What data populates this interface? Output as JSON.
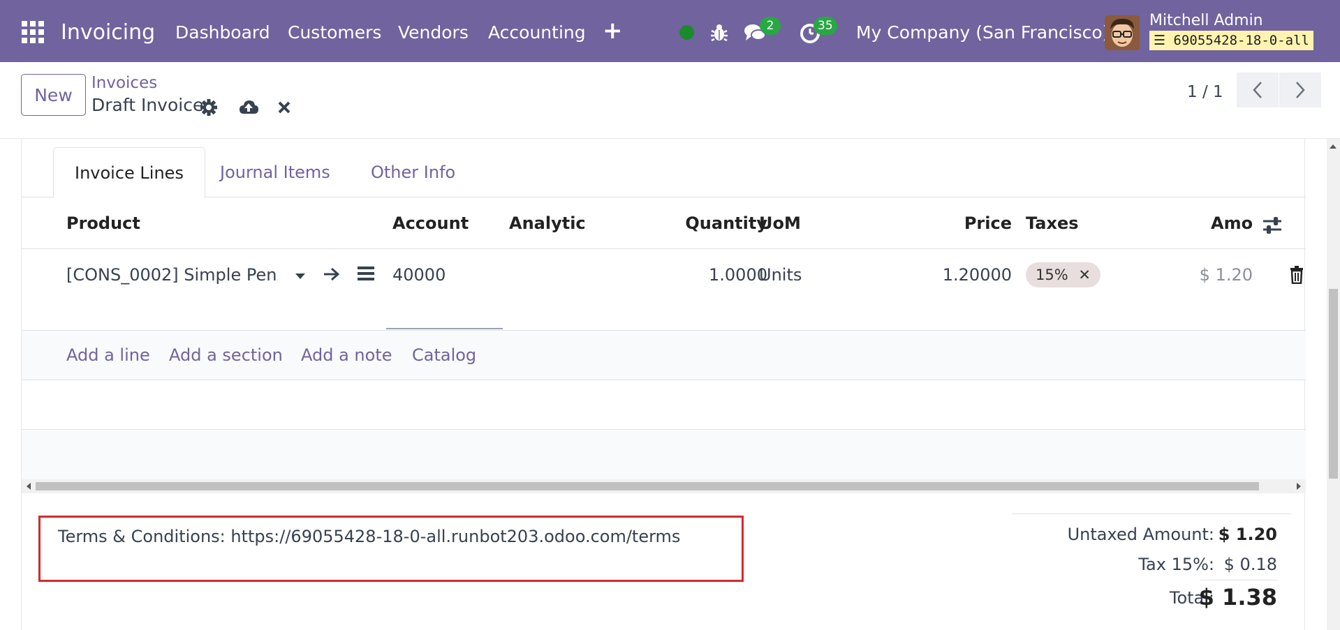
{
  "navbar": {
    "brand": "Invoicing",
    "menu": [
      "Dashboard",
      "Customers",
      "Vendors",
      "Accounting"
    ],
    "messages_count": "2",
    "activities_count": "35",
    "company": "My Company (San Francisco)",
    "user": "Mitchell Admin",
    "database": "69055428-18-0-all",
    "colors": {
      "bar": "#71639e",
      "badge": "#28a745",
      "status": "#1a8a2c"
    }
  },
  "control": {
    "new_label": "New",
    "breadcrumb_parent": "Invoices",
    "breadcrumb_current": "Draft Invoice",
    "pager": "1 / 1"
  },
  "tabs": [
    "Invoice Lines",
    "Journal Items",
    "Other Info"
  ],
  "table": {
    "headers": {
      "product": "Product",
      "account": "Account",
      "analytic": "Analytic",
      "quantity": "Quantity",
      "uom": "UoM",
      "price": "Price",
      "taxes": "Taxes",
      "amount": "Amou"
    },
    "rows": [
      {
        "product": "[CONS_0002] Simple Pen",
        "account": "40000",
        "analytic": "",
        "quantity": "1.0000",
        "uom": "Units",
        "price": "1.20000",
        "tax": "15%",
        "amount": "$ 1.20"
      }
    ],
    "add_actions": [
      "Add a line",
      "Add a section",
      "Add a note",
      "Catalog"
    ]
  },
  "terms": "Terms & Conditions: https://69055428-18-0-all.runbot203.odoo.com/terms",
  "totals": {
    "untaxed_label": "Untaxed Amount:",
    "untaxed_value": "$ 1.20",
    "tax_label": "Tax 15%:",
    "tax_value": "$ 0.18",
    "total_label": "Total:",
    "total_value": "$ 1.38"
  }
}
